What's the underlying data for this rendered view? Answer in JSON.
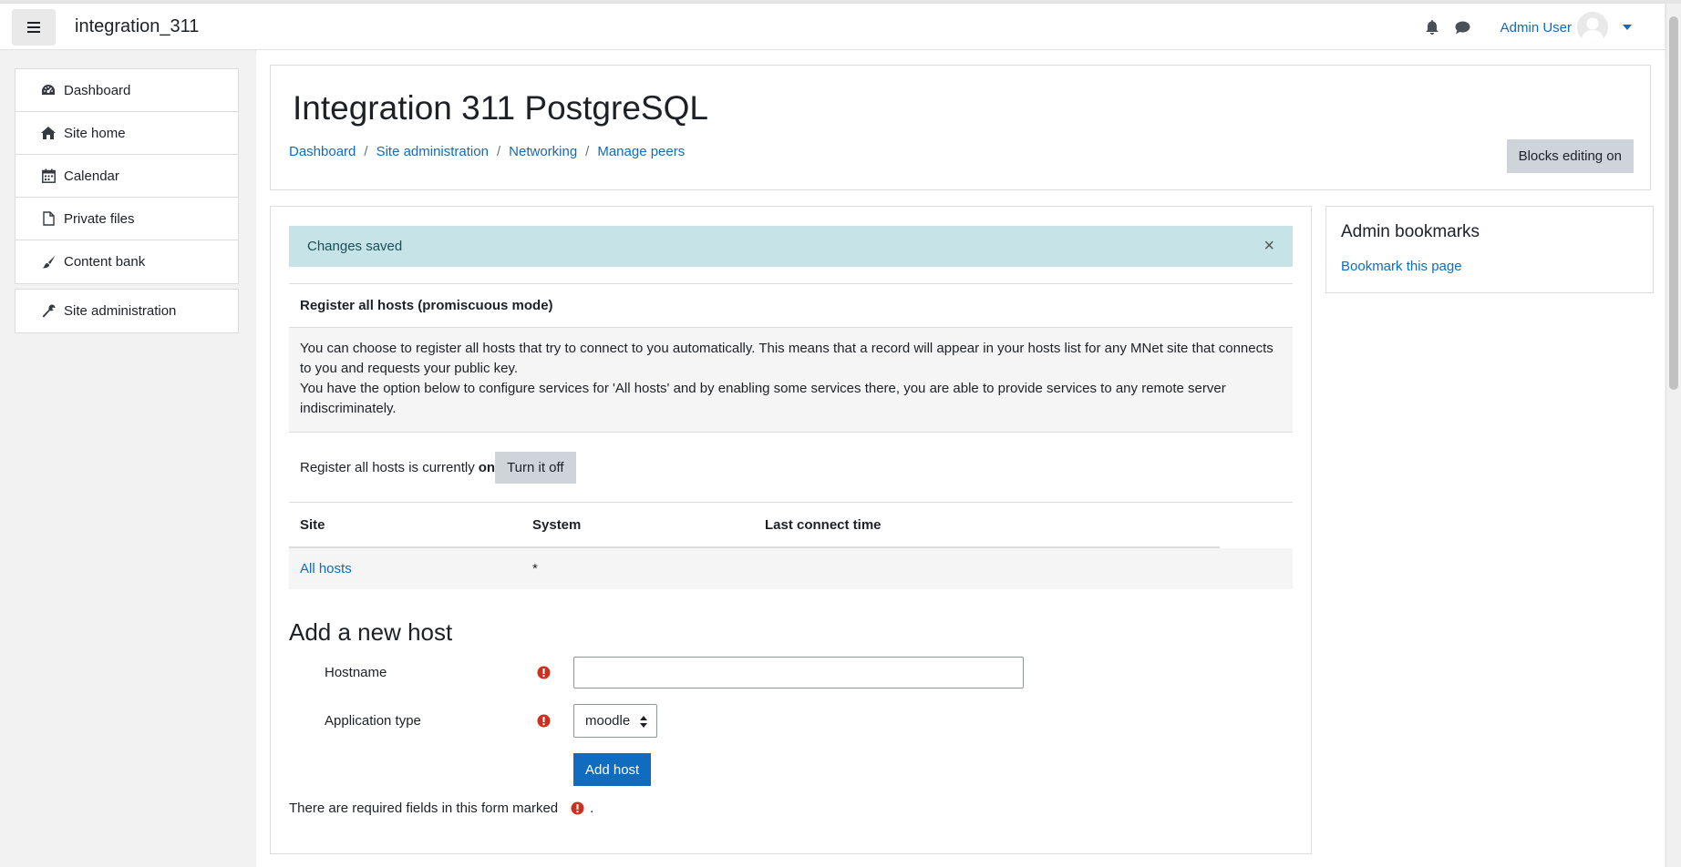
{
  "navbar": {
    "site_name": "integration_311",
    "user_name": "Admin User"
  },
  "drawer": {
    "main_items": [
      {
        "label": "Dashboard",
        "icon": "dashboard-icon"
      },
      {
        "label": "Site home",
        "icon": "home-icon"
      },
      {
        "label": "Calendar",
        "icon": "calendar-icon"
      },
      {
        "label": "Private files",
        "icon": "file-icon"
      },
      {
        "label": "Content bank",
        "icon": "brush-icon"
      }
    ],
    "admin_item": {
      "label": "Site administration",
      "icon": "wrench-icon"
    }
  },
  "header": {
    "title": "Integration 311 PostgreSQL",
    "breadcrumb": [
      "Dashboard",
      "Site administration",
      "Networking",
      "Manage peers"
    ],
    "blocks_button": "Blocks editing on"
  },
  "alert": {
    "message": "Changes saved",
    "close": "×"
  },
  "promiscuous": {
    "heading": "Register all hosts (promiscuous mode)",
    "desc_1": "You can choose to register all hosts that try to connect to you automatically. This means that a record will appear in your hosts list for any MNet site that connects to you and requests your public key.",
    "desc_2": "You have the option below to configure services for 'All hosts' and by enabling some services there, you are able to provide services to any remote server indiscriminately.",
    "status_text": "Register all hosts is currently",
    "status_value": "on",
    "toggle_button": "Turn it off"
  },
  "hosts_table": {
    "headers": [
      "Site",
      "System",
      "Last connect time"
    ],
    "rows": [
      {
        "site": "All hosts",
        "system": "*",
        "last_connect": ""
      }
    ]
  },
  "add_host": {
    "title": "Add a new host",
    "hostname_label": "Hostname",
    "hostname_value": "",
    "app_type_label": "Application type",
    "app_type_value": "moodle",
    "submit": "Add host",
    "required_note": "There are required fields in this form marked",
    "required_note_end": "."
  },
  "bookmarks": {
    "title": "Admin bookmarks",
    "link": "Bookmark this page"
  },
  "colors": {
    "link": "#0f6cbf",
    "alert_bg": "#c6e4e8",
    "required": "#ca3120",
    "button_grey": "#ced4da"
  }
}
